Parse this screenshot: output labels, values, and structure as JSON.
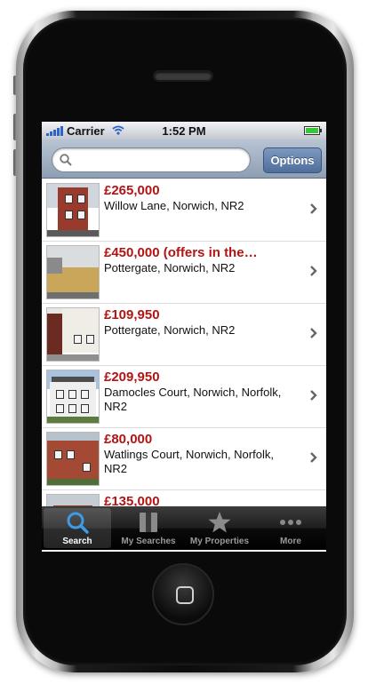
{
  "status_bar": {
    "carrier": "Carrier",
    "time": "1:52 PM",
    "battery_level": 1.0
  },
  "search": {
    "value": "",
    "placeholder": "",
    "options_label": "Options"
  },
  "listings": [
    {
      "price": "£265,000",
      "address": "Willow Lane, Norwich, NR2"
    },
    {
      "price": "£450,000 (offers in the…",
      "address": "Pottergate, Norwich, NR2"
    },
    {
      "price": "£109,950",
      "address": "Pottergate, Norwich, NR2"
    },
    {
      "price": "£209,950",
      "address": "Damocles Court, Norwich, Norfolk, NR2"
    },
    {
      "price": "£80,000",
      "address": "Watlings Court, Norwich, Norfolk, NR2"
    },
    {
      "price": "£135,000",
      "address": ""
    }
  ],
  "tabs": [
    {
      "label": "Search",
      "icon": "search-icon"
    },
    {
      "label": "My Searches",
      "icon": "bookmarks-icon"
    },
    {
      "label": "My Properties",
      "icon": "star-icon"
    },
    {
      "label": "More",
      "icon": "more-icon"
    }
  ],
  "colors": {
    "price": "#b41313",
    "accent": "#2c64c8",
    "nav_bar": "#8e9fb4",
    "tab_bar": "#000000"
  }
}
